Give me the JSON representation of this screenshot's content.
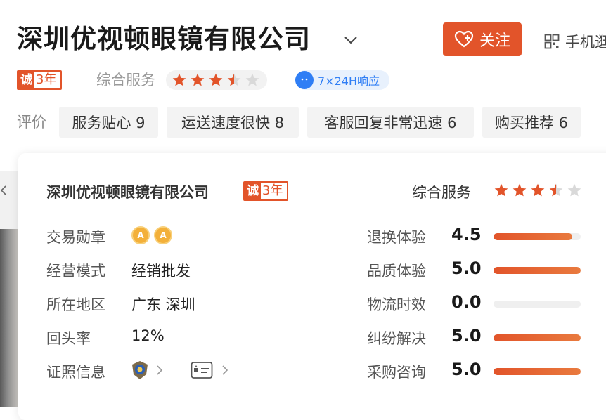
{
  "header": {
    "store_name": "深圳优视顿眼镜有限公司",
    "follow_label": "关注",
    "mobile_label": "手机逛"
  },
  "badge": {
    "cheng": "诚",
    "years": "3年"
  },
  "service": {
    "label": "综合服务",
    "rating": 3.5,
    "stars_total": 5
  },
  "response": {
    "label": "7×24H响应"
  },
  "reviews": {
    "label": "评价",
    "tags": [
      {
        "text": "服务贴心 9"
      },
      {
        "text": "运送速度很快 8"
      },
      {
        "text": "客服回复非常迅速 6"
      },
      {
        "text": "购买推荐 6"
      }
    ]
  },
  "card": {
    "title": "深圳优视顿眼镜有限公司",
    "service_label": "综合服务",
    "info": {
      "medals_label": "交易勋章",
      "medals": [
        "A",
        "A"
      ],
      "mode_label": "经营模式",
      "mode_value": "经销批发",
      "region_label": "所在地区",
      "region_value": "广东 深圳",
      "return_label": "回头率",
      "return_value": "12%",
      "license_label": "证照信息"
    },
    "metrics": [
      {
        "label": "退换体验",
        "score": "4.5",
        "fill": 0.9
      },
      {
        "label": "品质体验",
        "score": "5.0",
        "fill": 1.0
      },
      {
        "label": "物流时效",
        "score": "0.0",
        "fill": 0.0
      },
      {
        "label": "纠纷解决",
        "score": "5.0",
        "fill": 1.0
      },
      {
        "label": "采购咨询",
        "score": "5.0",
        "fill": 1.0
      }
    ]
  },
  "colors": {
    "accent": "#e2542a",
    "blue": "#2f7ef5",
    "track": "#efefef"
  }
}
